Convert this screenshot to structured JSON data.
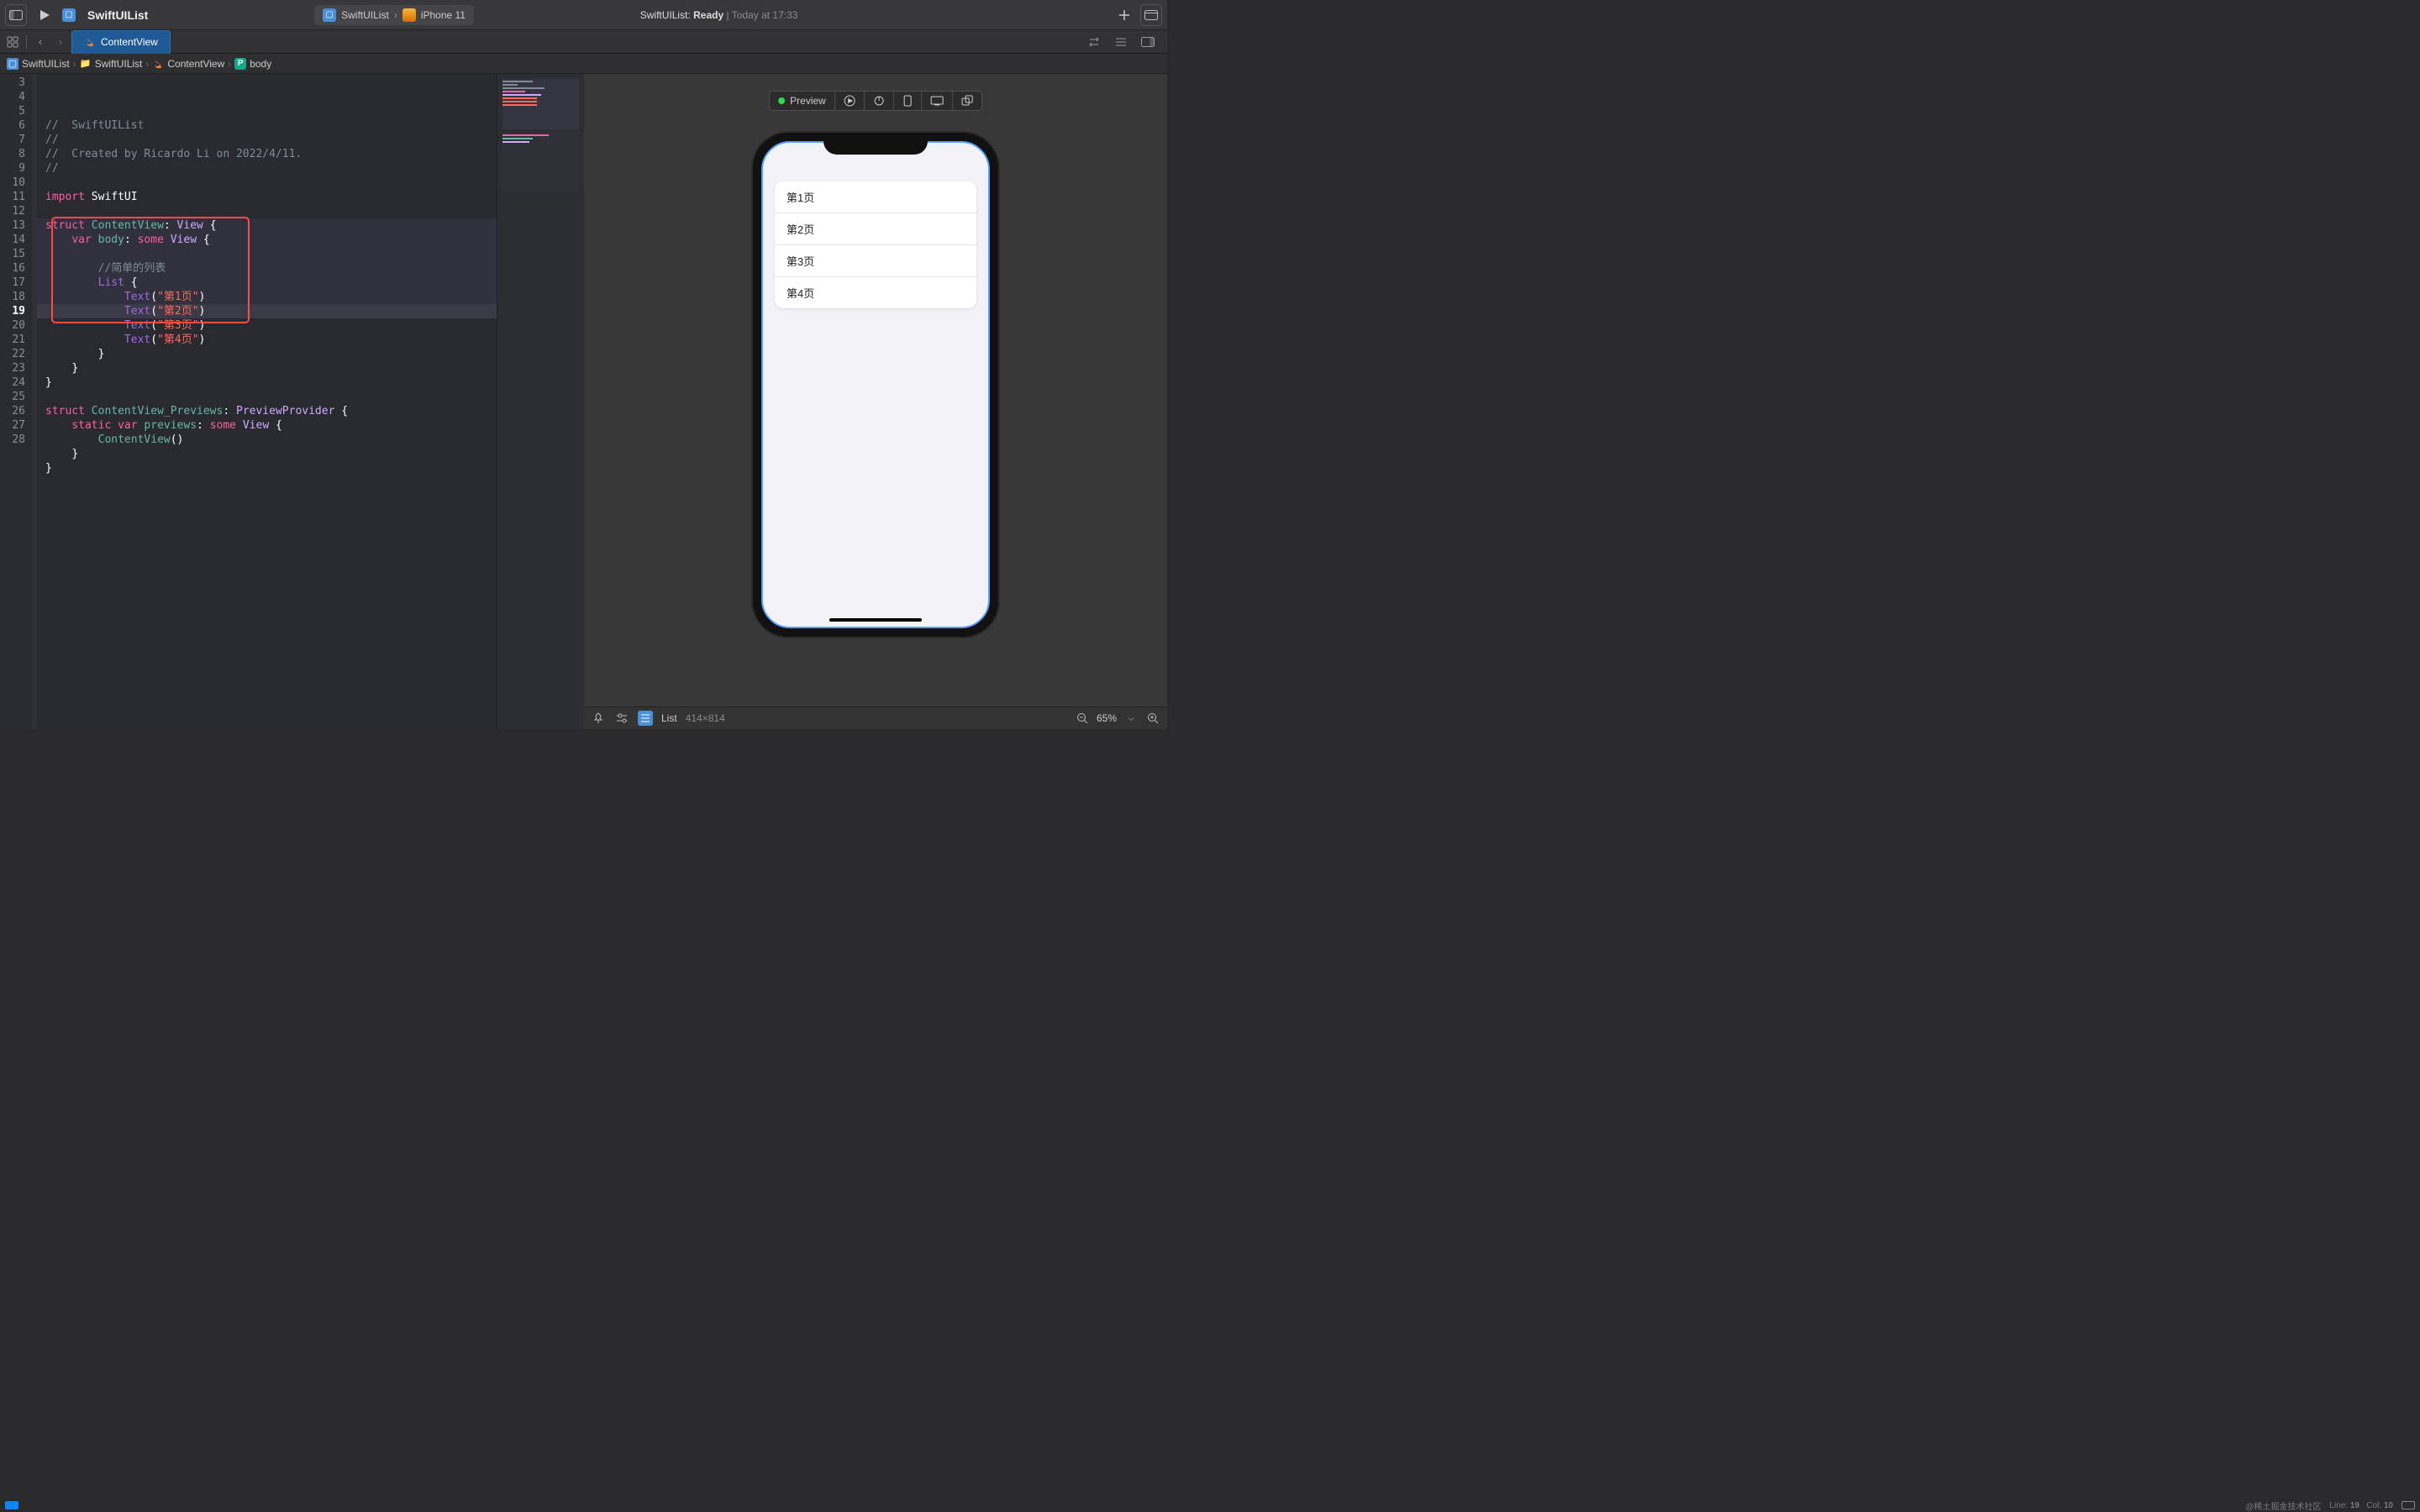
{
  "toolbar": {
    "project": "SwiftUIList",
    "scheme": {
      "app": "SwiftUIList",
      "target": "iPhone 11"
    },
    "status": {
      "prefix": "SwiftUIList: ",
      "emph": "Ready",
      "suffix": " | Today at 17:33"
    }
  },
  "tabbar": {
    "tabs": [
      {
        "label": "ContentView"
      }
    ]
  },
  "breadcrumb": {
    "project": "SwiftUIList",
    "group": "SwiftUIList",
    "file": "ContentView",
    "symbol": "body"
  },
  "code": {
    "lines": [
      {
        "n": 3,
        "html": "<span class='tok-comment'>//  SwiftUIList</span>"
      },
      {
        "n": 4,
        "html": "<span class='tok-comment'>//</span>"
      },
      {
        "n": 5,
        "html": "<span class='tok-comment'>//  Created by Ricardo Li on 2022/4/11.</span>"
      },
      {
        "n": 6,
        "html": "<span class='tok-comment'>//</span>"
      },
      {
        "n": 7,
        "html": ""
      },
      {
        "n": 8,
        "html": "<span class='tok-key'>import</span> <span class='tok-white'>SwiftUI</span>"
      },
      {
        "n": 9,
        "html": ""
      },
      {
        "n": 10,
        "html": "<span class='tok-key'>struct</span> <span class='tok-prop'>ContentView</span><span class='tok-white'>:</span> <span class='tok-type'>View</span> <span class='tok-white'>{</span>"
      },
      {
        "n": 11,
        "html": "    <span class='tok-key'>var</span> <span class='tok-prop'>body</span><span class='tok-white'>:</span> <span class='tok-key'>some</span> <span class='tok-type'>View</span> <span class='tok-white'>{</span>"
      },
      {
        "n": 12,
        "html": ""
      },
      {
        "n": 13,
        "html": "        <span class='tok-comment'>//简单的列表</span>"
      },
      {
        "n": 14,
        "html": "        <span class='tok-builtin'>List</span> <span class='tok-white'>{</span>"
      },
      {
        "n": 15,
        "html": "            <span class='tok-builtin'>Text</span><span class='tok-white'>(</span><span class='tok-str'>\"第1页\"</span><span class='tok-white'>)</span>"
      },
      {
        "n": 16,
        "html": "            <span class='tok-builtin'>Text</span><span class='tok-white'>(</span><span class='tok-str'>\"第2页\"</span><span class='tok-white'>)</span>"
      },
      {
        "n": 17,
        "html": "            <span class='tok-builtin'>Text</span><span class='tok-white'>(</span><span class='tok-str'>\"第3页\"</span><span class='tok-white'>)</span>"
      },
      {
        "n": 18,
        "html": "            <span class='tok-builtin'>Text</span><span class='tok-white'>(</span><span class='tok-str'>\"第4页\"</span><span class='tok-white'>)</span>"
      },
      {
        "n": 19,
        "html": "        <span class='tok-white'>}</span>"
      },
      {
        "n": 20,
        "html": "    <span class='tok-white'>}</span>"
      },
      {
        "n": 21,
        "html": "<span class='tok-white'>}</span>"
      },
      {
        "n": 22,
        "html": ""
      },
      {
        "n": 23,
        "html": "<span class='tok-key'>struct</span> <span class='tok-prop'>ContentView_Previews</span><span class='tok-white'>:</span> <span class='tok-type'>PreviewProvider</span> <span class='tok-white'>{</span>"
      },
      {
        "n": 24,
        "html": "    <span class='tok-key'>static</span> <span class='tok-key'>var</span> <span class='tok-prop'>previews</span><span class='tok-white'>:</span> <span class='tok-key'>some</span> <span class='tok-type'>View</span> <span class='tok-white'>{</span>"
      },
      {
        "n": 25,
        "html": "        <span class='tok-prop'>ContentView</span><span class='tok-white'>()</span>"
      },
      {
        "n": 26,
        "html": "    <span class='tok-white'>}</span>"
      },
      {
        "n": 27,
        "html": "<span class='tok-white'>}</span>"
      },
      {
        "n": 28,
        "html": ""
      }
    ],
    "highlight_block": {
      "from": 13,
      "to": 19
    },
    "current_line": 19
  },
  "preview": {
    "toolbar_label": "Preview",
    "list_items": [
      "第1页",
      "第2页",
      "第3页",
      "第4页"
    ]
  },
  "canvasbar": {
    "element": "List",
    "size": "414×814",
    "zoom": "65%"
  },
  "status": {
    "line_label": "Line:",
    "line": "19",
    "col_label": "Col:",
    "col": "10",
    "watermark": "@稀土掘金技术社区"
  }
}
